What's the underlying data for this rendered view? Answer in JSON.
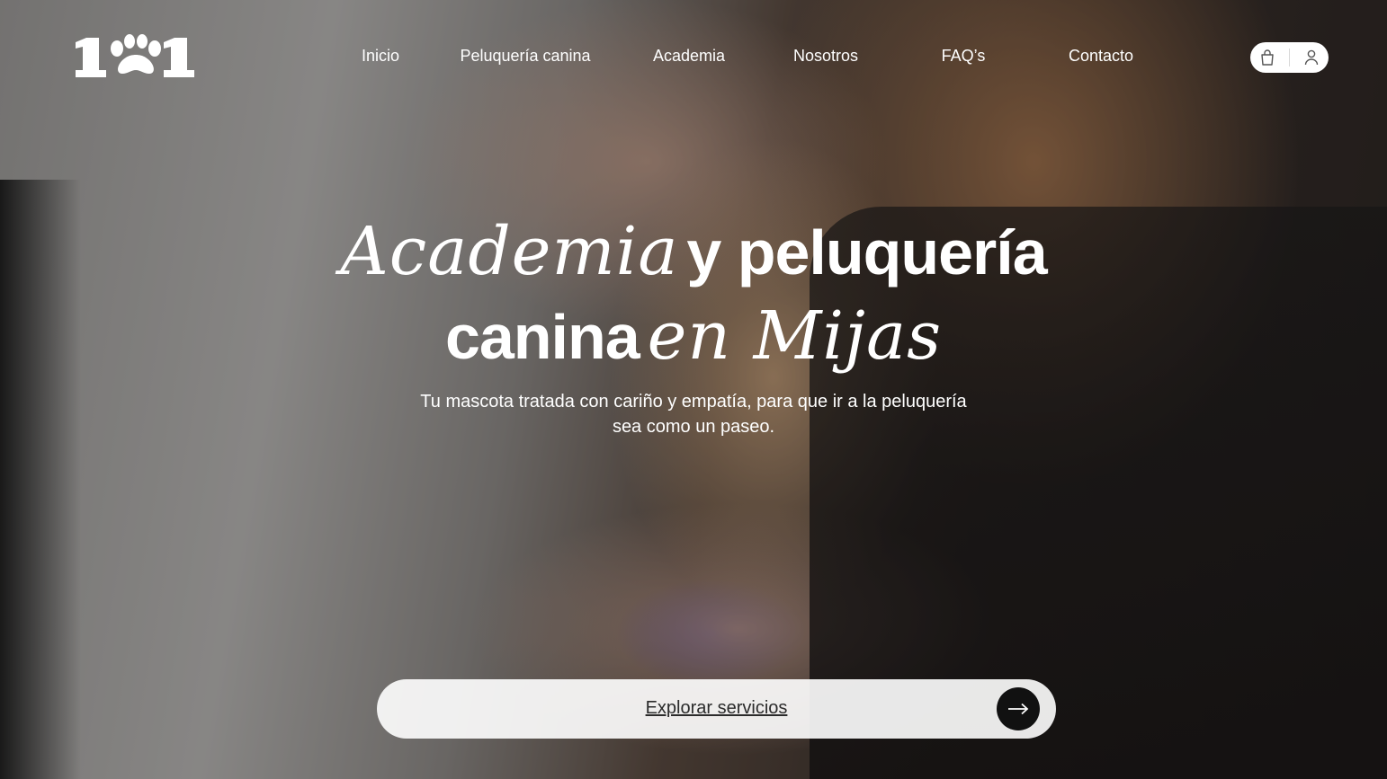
{
  "header": {
    "logo_icon": "paw-print-logo",
    "nav": [
      {
        "label": "Inicio"
      },
      {
        "label": "Peluquería canina"
      },
      {
        "label": "Academia"
      },
      {
        "label": "Nosotros"
      },
      {
        "label": "FAQ’s"
      },
      {
        "label": "Contacto"
      }
    ],
    "icons": {
      "cart": "shopping-bag-icon",
      "account": "user-icon"
    }
  },
  "hero": {
    "headline": {
      "line1_serif": "Academia",
      "line1_sans": "y peluquería",
      "line2_sans": "canina",
      "line2_serif": "en Mijas"
    },
    "subtitle": {
      "line1": "Tu mascota tratada con cariño y empatía, para que ir a la peluquería",
      "line2": "sea como un paseo."
    },
    "cta": {
      "label": "Explorar servicios",
      "icon": "arrow-right-icon"
    }
  },
  "colors": {
    "text": "#ffffff",
    "cta_bg": "#ffffff",
    "cta_text": "#2b2b2b",
    "cta_arrow_bg": "#111111"
  }
}
